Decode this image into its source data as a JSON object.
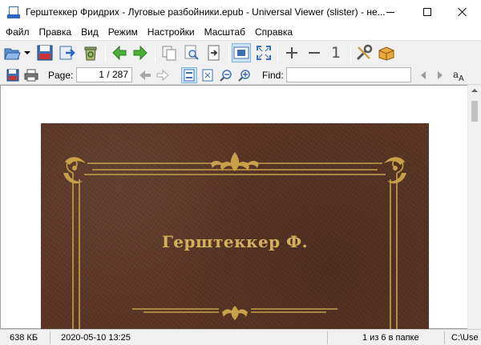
{
  "window": {
    "title": "Герштеккер Фридрих - Луговые разбойники.epub - Universal Viewer (slister) - не..."
  },
  "menu": [
    "Файл",
    "Правка",
    "Вид",
    "Режим",
    "Настройки",
    "Масштаб",
    "Справка"
  ],
  "toolbar1": {
    "icons": [
      "open-icon",
      "dropdown-arrow-icon",
      "save-icon",
      "reload-icon",
      "delete-icon",
      "back-arrow-icon",
      "forward-arrow-icon",
      "copy-icon",
      "print-preview-icon",
      "export-icon",
      "fit-window-icon",
      "fullscreen-icon",
      "zoom-in-icon",
      "zoom-out-icon",
      "original-size-icon",
      "tools-icon",
      "package-icon"
    ],
    "original_size_label": "1"
  },
  "toolbar2": {
    "page_label": "Page:",
    "page_value": "1 / 287",
    "find_label": "Find:",
    "find_value": ""
  },
  "book": {
    "author": "Герштеккер Ф."
  },
  "colors": {
    "cover_leather": "#5a3524",
    "gold": "#d5b05c",
    "accent": "#2c66c4"
  },
  "statusbar": {
    "size": "638 КБ",
    "date": "2020-05-10 13:25",
    "position": "1 из 6 в папке",
    "path": "C:\\Use"
  }
}
